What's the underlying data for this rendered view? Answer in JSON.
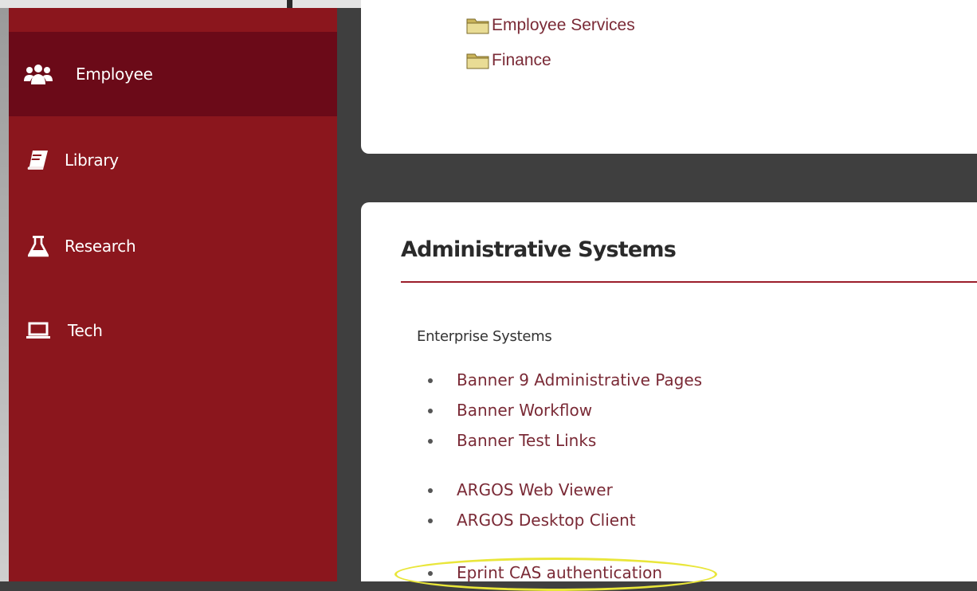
{
  "sidebar": {
    "items": [
      {
        "label": "Employee",
        "icon": "users-icon",
        "active": true
      },
      {
        "label": "Library",
        "icon": "book-icon",
        "active": false
      },
      {
        "label": "Research",
        "icon": "flask-icon",
        "active": false
      },
      {
        "label": "Tech",
        "icon": "laptop-icon",
        "active": false
      }
    ]
  },
  "top_panel": {
    "folders": [
      {
        "label": "Employee Services",
        "icon": "folder-icon"
      },
      {
        "label": "Finance",
        "icon": "folder-icon"
      }
    ]
  },
  "main": {
    "title": "Administrative Systems",
    "subhead": "Enterprise Systems",
    "group1": [
      "Banner 9 Administrative Pages",
      "Banner Workflow",
      "Banner Test Links"
    ],
    "group2": [
      "ARGOS Web Viewer",
      "ARGOS Desktop Client"
    ],
    "group3": [
      "Eprint CAS authentication"
    ]
  },
  "colors": {
    "sidebar": "#8b161d",
    "sidebar_active": "#6b0a18",
    "link": "#7a2a36",
    "rule": "#9b1d2a",
    "highlight": "#e9e63a"
  }
}
